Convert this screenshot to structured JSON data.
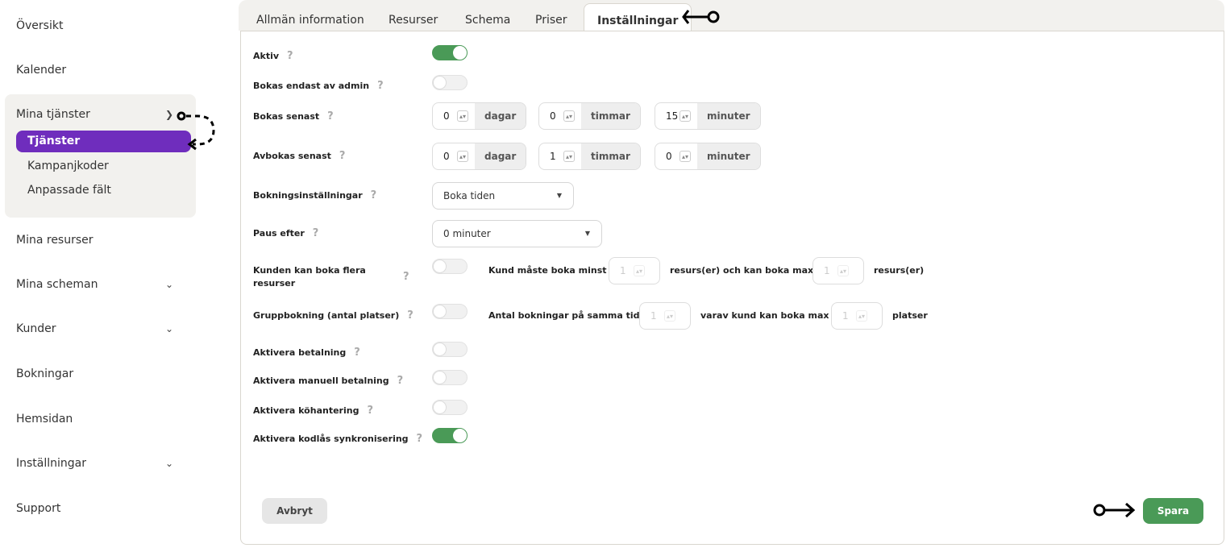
{
  "sidebar": {
    "items": [
      {
        "label": "Översikt"
      },
      {
        "label": "Kalender"
      },
      {
        "label": "Mina tjänster"
      },
      {
        "label": "Mina resurser"
      },
      {
        "label": "Mina scheman"
      },
      {
        "label": "Kunder"
      },
      {
        "label": "Bokningar"
      },
      {
        "label": "Hemsidan"
      },
      {
        "label": "Inställningar"
      },
      {
        "label": "Support"
      }
    ],
    "sub_items": [
      {
        "label": "Tjänster",
        "active": true
      },
      {
        "label": "Kampanjkoder"
      },
      {
        "label": "Anpassade fält"
      }
    ]
  },
  "tabs": [
    {
      "label": "Allmän information"
    },
    {
      "label": "Resurser"
    },
    {
      "label": "Schema"
    },
    {
      "label": "Priser"
    },
    {
      "label": "Inställningar",
      "active": true
    }
  ],
  "settings": {
    "help": "?",
    "aktiv": {
      "label": "Aktiv",
      "on": true
    },
    "admin_only": {
      "label": "Bokas endast av admin",
      "on": false
    },
    "book_latest": {
      "label": "Bokas senast",
      "days": "0",
      "hours": "0",
      "minutes": "15"
    },
    "cancel_latest": {
      "label": "Avbokas senast",
      "days": "0",
      "hours": "1",
      "minutes": "0"
    },
    "units": {
      "days": "dagar",
      "hours": "timmar",
      "minutes": "minuter"
    },
    "booking_settings": {
      "label": "Bokningsinställningar",
      "value": "Boka tiden"
    },
    "pause_after": {
      "label": "Paus efter",
      "value": "0 minuter"
    },
    "multi_resources": {
      "label": "Kunden kan boka flera resurser",
      "on": false,
      "min_text": "Kund måste boka minst",
      "min": "1",
      "max_text": "resurs(er) och kan boka max",
      "max": "1",
      "suffix": "resurs(er)"
    },
    "group_booking": {
      "label": "Gruppbokning (antal platser)",
      "on": false,
      "count_text": "Antal bokningar på samma tid",
      "count": "1",
      "max_text": "varav kund kan boka max",
      "max": "1",
      "suffix": "platser"
    },
    "payment": {
      "label": "Aktivera betalning",
      "on": false
    },
    "manual_payment": {
      "label": "Aktivera manuell betalning",
      "on": false
    },
    "queue": {
      "label": "Aktivera köhantering",
      "on": false
    },
    "codelock": {
      "label": "Aktivera kodlås synkronisering",
      "on": true
    }
  },
  "actions": {
    "cancel": "Avbryt",
    "save": "Spara"
  },
  "colors": {
    "accent": "#6f2dbd",
    "success": "#4a9a57"
  }
}
